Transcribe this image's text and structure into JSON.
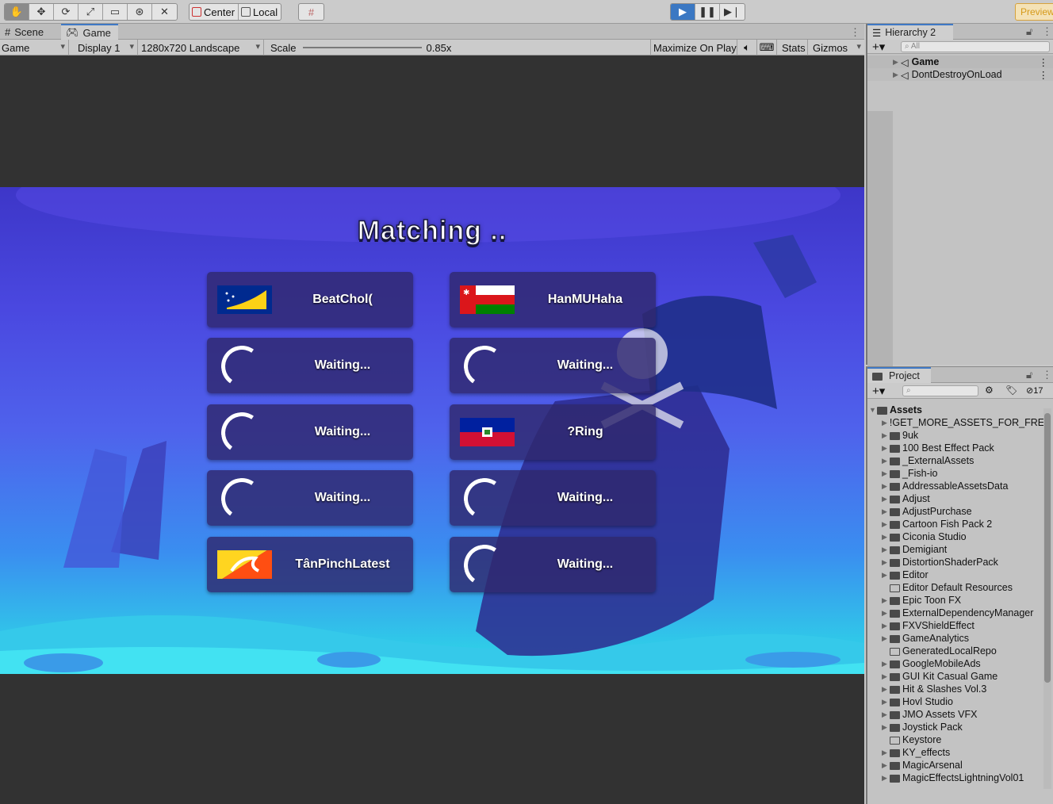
{
  "toolbar": {
    "tools": [
      "hand-tool-icon",
      "move-tool-icon",
      "rotate-tool-icon",
      "scale-tool-icon",
      "rect-tool-icon",
      "transform-tool-icon",
      "custom-tool-icon"
    ],
    "center_label": "Center",
    "local_label": "Local",
    "preview_label": "Preview"
  },
  "game_panel": {
    "tabs": [
      {
        "label": "Scene"
      },
      {
        "label": "Game"
      }
    ],
    "display_mode": "Game",
    "display": "Display 1",
    "resolution": "1280x720 Landscape",
    "scale_label": "Scale",
    "scale_value": "0.85x",
    "maximize_label": "Maximize On Play",
    "stats_label": "Stats",
    "gizmos_label": "Gizmos"
  },
  "game": {
    "title": "Matching ..",
    "slots": [
      {
        "name": "BeatChol(",
        "status": "player",
        "flag": "tokelau"
      },
      {
        "name": "HanMUHaha",
        "status": "player",
        "flag": "oman"
      },
      {
        "name": "Waiting...",
        "status": "waiting"
      },
      {
        "name": "Waiting...",
        "status": "waiting"
      },
      {
        "name": "Waiting...",
        "status": "waiting"
      },
      {
        "name": "?Ring",
        "status": "player",
        "flag": "haiti"
      },
      {
        "name": "Waiting...",
        "status": "waiting"
      },
      {
        "name": "Waiting...",
        "status": "waiting"
      },
      {
        "name": "TânPinchLatest",
        "status": "player",
        "flag": "bhutan"
      },
      {
        "name": "Waiting...",
        "status": "waiting"
      }
    ]
  },
  "hierarchy": {
    "title": "Hierarchy 2",
    "search_placeholder": "All",
    "items": [
      {
        "label": "Game"
      },
      {
        "label": "DontDestroyOnLoad"
      }
    ]
  },
  "project": {
    "title": "Project",
    "hidden_count": "17",
    "root_label": "Assets",
    "folders": [
      {
        "label": "!GET_MORE_ASSETS_FOR_FREE",
        "expandable": true
      },
      {
        "label": "9uk",
        "expandable": true
      },
      {
        "label": "100 Best Effect Pack",
        "expandable": true
      },
      {
        "label": "_ExternalAssets",
        "expandable": true
      },
      {
        "label": "_Fish-io",
        "expandable": true
      },
      {
        "label": "AddressableAssetsData",
        "expandable": true
      },
      {
        "label": "Adjust",
        "expandable": true
      },
      {
        "label": "AdjustPurchase",
        "expandable": true
      },
      {
        "label": "Cartoon Fish Pack 2",
        "expandable": true
      },
      {
        "label": "Ciconia Studio",
        "expandable": true
      },
      {
        "label": "Demigiant",
        "expandable": true
      },
      {
        "label": "DistortionShaderPack",
        "expandable": true
      },
      {
        "label": "Editor",
        "expandable": true
      },
      {
        "label": "Editor Default Resources",
        "expandable": false
      },
      {
        "label": "Epic Toon FX",
        "expandable": true
      },
      {
        "label": "ExternalDependencyManager",
        "expandable": true
      },
      {
        "label": "FXVShieldEffect",
        "expandable": true
      },
      {
        "label": "GameAnalytics",
        "expandable": true
      },
      {
        "label": "GeneratedLocalRepo",
        "expandable": false
      },
      {
        "label": "GoogleMobileAds",
        "expandable": true
      },
      {
        "label": "GUI Kit Casual Game",
        "expandable": true
      },
      {
        "label": "Hit & Slashes Vol.3",
        "expandable": true
      },
      {
        "label": "Hovl Studio",
        "expandable": true
      },
      {
        "label": "JMO Assets VFX",
        "expandable": true
      },
      {
        "label": "Joystick Pack",
        "expandable": true
      },
      {
        "label": "Keystore",
        "expandable": false
      },
      {
        "label": "KY_effects",
        "expandable": true
      },
      {
        "label": "MagicArsenal",
        "expandable": true
      },
      {
        "label": "MagicEffectsLightningVol01",
        "expandable": true
      }
    ]
  },
  "colors": {
    "accent": "#3b78c3",
    "game_bg_top": "#3d36c8",
    "game_bg_bottom": "#38dff0",
    "slot_bg": "#30286e"
  }
}
